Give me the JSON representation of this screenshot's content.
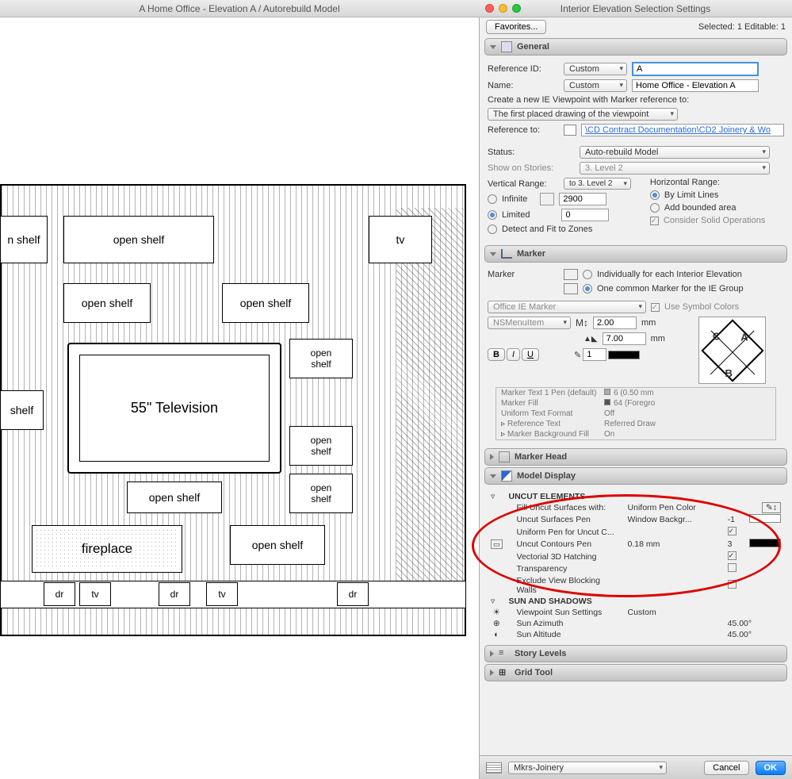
{
  "main_window": {
    "title": "A Home Office - Elevation A / Autorebuild Model"
  },
  "panel_window": {
    "title": "Interior Elevation Selection Settings"
  },
  "toprow": {
    "favorites": "Favorites...",
    "selected": "Selected: 1 Editable: 1"
  },
  "sections": {
    "general": "General",
    "marker": "Marker",
    "marker_head": "Marker Head",
    "model_display": "Model Display",
    "story_levels": "Story Levels",
    "grid_tool": "Grid Tool"
  },
  "general": {
    "ref_id_lbl": "Reference ID:",
    "ref_id_sel": "Custom",
    "ref_id_val": "A",
    "name_lbl": "Name:",
    "name_sel": "Custom",
    "name_val": "Home Office - Elevation A",
    "create_vp": "Create a new IE Viewpoint with Marker reference to:",
    "vp_option": "The first placed drawing of the viewpoint",
    "ref_to_lbl": "Reference to:",
    "ref_to_val": "\\CD Contract Documentation\\CD2 Joinery & Wo",
    "status_lbl": "Status:",
    "status_val": "Auto-rebuild Model",
    "stories_lbl": "Show on Stories:",
    "stories_val": "3. Level 2",
    "vrange_lbl": "Vertical Range:",
    "vrange_to": "to 3. Level 2",
    "infinite": "Infinite",
    "limited": "Limited",
    "vtop": "2900",
    "vbot": "0",
    "detect": "Detect and Fit to Zones",
    "hrange_lbl": "Horizontal Range:",
    "bylimit": "By Limit Lines",
    "addbound": "Add bounded area",
    "consider": "Consider Solid Operations"
  },
  "marker": {
    "lbl": "Marker",
    "indiv": "Individually for each Interior Elevation",
    "common": "One common Marker for the IE Group",
    "type": "Office IE Marker",
    "use_symbol": "Use Symbol Colors",
    "ns": "NSMenuItem",
    "m1": "2.00",
    "m2": "7.00",
    "mm": "mm",
    "text1": "1",
    "rows": {
      "r1a": "Marker Text 1 Pen (default)",
      "r1b": "6 (0.50 mm",
      "r2a": "Marker Fill",
      "r2b": "64 (Foregro",
      "r3a": "Uniform Text Format",
      "r3b": "Off",
      "r4a": "Reference Text",
      "r4b": "Referred Draw",
      "r5a": "Marker Background Fill",
      "r5b": "On"
    }
  },
  "model": {
    "cat1": "UNCUT ELEMENTS",
    "r1a": "Fill Uncut Surfaces with:",
    "r1b": "Uniform Pen Color",
    "r2a": "Uncut Surfaces Pen",
    "r2b": "Window Backgr...",
    "r2c": "-1",
    "r3a": "Uniform Pen for Uncut C...",
    "r4a": "Uncut Contours Pen",
    "r4b": "0.18 mm",
    "r4c": "3",
    "r5a": "Vectorial 3D Hatching",
    "r6a": "Transparency",
    "r7a": "Exclude View Blocking Walls",
    "cat2": "SUN AND SHADOWS",
    "r8a": "Viewpoint Sun Settings",
    "r8b": "Custom",
    "r9a": "Sun Azimuth",
    "r9b": "45.00°",
    "r10a": "Sun Altitude",
    "r10b": "45.00°"
  },
  "bottom": {
    "layer": "Mkrs-Joinery",
    "cancel": "Cancel",
    "ok": "OK"
  },
  "drawing": {
    "tv": "55\" Television",
    "open_shelf": "open shelf",
    "n_shelf": "n shelf",
    "shelf": "shelf",
    "open": "open",
    "tv_small": "tv",
    "fireplace": "fireplace",
    "dr": "dr"
  },
  "preview_letters": {
    "a": "A",
    "b": "B",
    "c": "C"
  }
}
